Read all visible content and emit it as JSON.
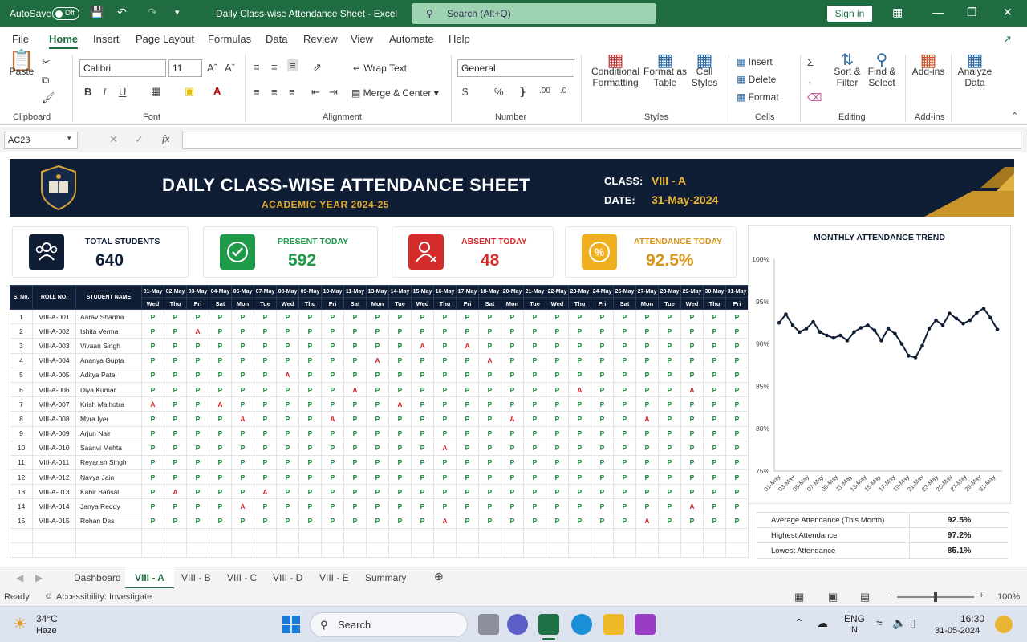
{
  "titlebar": {
    "autosave": "AutoSave",
    "toggle": "Off",
    "title": "Daily Class-wise Attendance Sheet  -  Excel",
    "search": "Search (Alt+Q)",
    "signin": "Sign in"
  },
  "ribbon_tabs": [
    "File",
    "Home",
    "Insert",
    "Page Layout",
    "Formulas",
    "Data",
    "Review",
    "View",
    "Automate",
    "Help"
  ],
  "ribbon": {
    "paste": "Paste",
    "clipboard": "Clipboard",
    "font_name": "Calibri",
    "font_size": "11",
    "font": "Font",
    "wrap": "Wrap Text",
    "merge": "Merge & Center",
    "alignment": "Alignment",
    "number_format": "General",
    "number": "Number",
    "cond_l1": "Conditional",
    "cond_l2": "Formatting",
    "fmt_l1": "Format as",
    "fmt_l2": "Table",
    "cell_l1": "Cell",
    "cell_l2": "Styles",
    "styles": "Styles",
    "insert": "Insert",
    "delete": "Delete",
    "format": "Format",
    "cells": "Cells",
    "sort_l1": "Sort &",
    "sort_l2": "Filter",
    "find_l1": "Find &",
    "find_l2": "Select",
    "editing": "Editing",
    "addins": "Add-ins",
    "addins_group": "Add-ins",
    "analyze_l1": "Analyze",
    "analyze_l2": "Data"
  },
  "namebox": "AC23",
  "banner": {
    "title": "DAILY CLASS-WISE ATTENDANCE SHEET",
    "subtitle": "ACADEMIC YEAR 2024-25",
    "class_label": "CLASS:",
    "class_value": "VIII - A",
    "date_label": "DATE:",
    "date_value": "31-May-2024"
  },
  "cards": [
    {
      "label": "TOTAL STUDENTS",
      "value": "640"
    },
    {
      "label": "PRESENT TODAY",
      "value": "592"
    },
    {
      "label": "ABSENT TODAY",
      "value": "48"
    },
    {
      "label": "ATTENDANCE TODAY",
      "value": "92.5%"
    }
  ],
  "table": {
    "headers": [
      "S. No.",
      "ROLL NO.",
      "STUDENT NAME"
    ],
    "dates": [
      "01-May",
      "02-May",
      "03-May",
      "04-May",
      "06-May",
      "07-May",
      "08-May",
      "09-May",
      "10-May",
      "11-May",
      "13-May",
      "14-May",
      "15-May",
      "16-May",
      "17-May",
      "18-May",
      "20-May",
      "21-May",
      "22-May",
      "23-May",
      "24-May",
      "25-May",
      "27-May",
      "28-May",
      "29-May",
      "30-May",
      "31-May"
    ],
    "days": [
      "Wed",
      "Thu",
      "Fri",
      "Sat",
      "Mon",
      "Tue",
      "Wed",
      "Thu",
      "Fri",
      "Sat",
      "Mon",
      "Tue",
      "Wed",
      "Thu",
      "Fri",
      "Sat",
      "Mon",
      "Tue",
      "Wed",
      "Thu",
      "Fri",
      "Sat",
      "Mon",
      "Tue",
      "Wed",
      "Thu",
      "Fri"
    ],
    "rows": [
      {
        "sno": "1",
        "roll": "VIII-A-001",
        "name": "Aarav Sharma",
        "att": "PPPPPPPPPPPPPPPPPPPPPPPPPPP"
      },
      {
        "sno": "2",
        "roll": "VIII-A-002",
        "name": "Ishita Verma",
        "att": "PPAPPPPPPPPPPPPPPPPPPPPPPPP"
      },
      {
        "sno": "3",
        "roll": "VIII-A-003",
        "name": "Vivaan Singh",
        "att": "PPPPPPPPPPPPAPAPPPPPPPPPPPP"
      },
      {
        "sno": "4",
        "roll": "VIII-A-004",
        "name": "Ananya Gupta",
        "att": "PPPPPPPPPPAPPPPAPPPPPPPPPPP"
      },
      {
        "sno": "5",
        "roll": "VIII-A-005",
        "name": "Aditya Patel",
        "att": "PPPPPPAPPPPPPPPPPPPPPPPPPPP"
      },
      {
        "sno": "6",
        "roll": "VIII-A-006",
        "name": "Diya Kumar",
        "att": "PPPPPPPPPAPPPPPPPPPAPPPPAPP"
      },
      {
        "sno": "7",
        "roll": "VIII-A-007",
        "name": "Krish Malhotra",
        "att": "APPAPPPPPPPAPPPPPPPPPPPPPPP"
      },
      {
        "sno": "8",
        "roll": "VIII-A-008",
        "name": "Myra Iyer",
        "att": "PPPPAPPPAPPPPPPPAPPPPPAPPPP"
      },
      {
        "sno": "9",
        "roll": "VIII-A-009",
        "name": "Arjun Nair",
        "att": "PPPPPPPPPPPPPPPPPPPPPPPPPPP"
      },
      {
        "sno": "10",
        "roll": "VIII-A-010",
        "name": "Saanvi Mehta",
        "att": "PPPPPPPPPPPPPAPPPPPPPPPPPPP"
      },
      {
        "sno": "11",
        "roll": "VIII-A-011",
        "name": "Reyansh Singh",
        "att": "PPPPPPPPPPPPPPPPPPPPPPPPPPP"
      },
      {
        "sno": "12",
        "roll": "VIII-A-012",
        "name": "Navya Jain",
        "att": "PPPPPPPPPPPPPPPPPPPPPPPPPPP"
      },
      {
        "sno": "13",
        "roll": "VIII-A-013",
        "name": "Kabir Bansal",
        "att": "PAPPPAPPPPPPPPPPPPPPPPPPPPP"
      },
      {
        "sno": "14",
        "roll": "VIII-A-014",
        "name": "Janya Reddy",
        "att": "PPPPAPPPPPPPPPPPPPPPPPPPAPP"
      },
      {
        "sno": "15",
        "roll": "VIII-A-015",
        "name": "Rohan Das",
        "att": "PPPPPPPPPPPPPAPPPPPPPPAPPPP"
      }
    ]
  },
  "chart_data": {
    "type": "line",
    "title": "MONTHLY ATTENDANCE TREND",
    "ylim": [
      75,
      100
    ],
    "yticks": [
      "100%",
      "95%",
      "90%",
      "85%",
      "80%",
      "75%"
    ],
    "x": [
      "01-May",
      "02-May",
      "03-May",
      "04-May",
      "06-May",
      "07-May",
      "08-May",
      "09-May",
      "10-May",
      "11-May",
      "13-May",
      "14-May",
      "15-May",
      "16-May",
      "17-May",
      "18-May",
      "20-May",
      "21-May",
      "22-May",
      "23-May",
      "24-May",
      "25-May",
      "27-May",
      "28-May",
      "29-May",
      "30-May",
      "31-May"
    ],
    "xtick_labels": [
      "01-May",
      "03-May",
      "05-May",
      "07-May",
      "09-May",
      "11-May",
      "13-May",
      "15-May",
      "17-May",
      "19-May",
      "21-May",
      "23-May",
      "25-May",
      "27-May",
      "29-May",
      "31-May"
    ],
    "series": [
      {
        "values": [
          92.5,
          93.5,
          92.2,
          91.4,
          91.8,
          92.6,
          91.4,
          91.0,
          90.7,
          91.0,
          90.4,
          91.4,
          91.9,
          92.2,
          91.6,
          90.4,
          91.8,
          91.2,
          90.0,
          88.6,
          88.4,
          89.8,
          91.8,
          92.8,
          92.2,
          93.6,
          93.0,
          92.4,
          92.8,
          93.7,
          94.2,
          93.1,
          91.7
        ]
      }
    ],
    "color": "#0f1d35"
  },
  "stats": [
    {
      "label": "Average Attendance (This Month)",
      "value": "92.5%"
    },
    {
      "label": "Highest Attendance",
      "value": "97.2%"
    },
    {
      "label": "Lowest Attendance",
      "value": "85.1%"
    }
  ],
  "sheet_tabs": [
    "Dashboard",
    "VIII - A",
    "VIII - B",
    "VIII - C",
    "VIII - D",
    "VIII - E",
    "Summary"
  ],
  "status": {
    "ready": "Ready",
    "accessibility": "Accessibility: Investigate",
    "zoom": "100%"
  },
  "taskbar": {
    "temp": "34°C",
    "weather": "Haze",
    "search": "Search",
    "lang1": "ENG",
    "lang2": "IN",
    "time": "16:30",
    "date": "31-05-2024"
  }
}
